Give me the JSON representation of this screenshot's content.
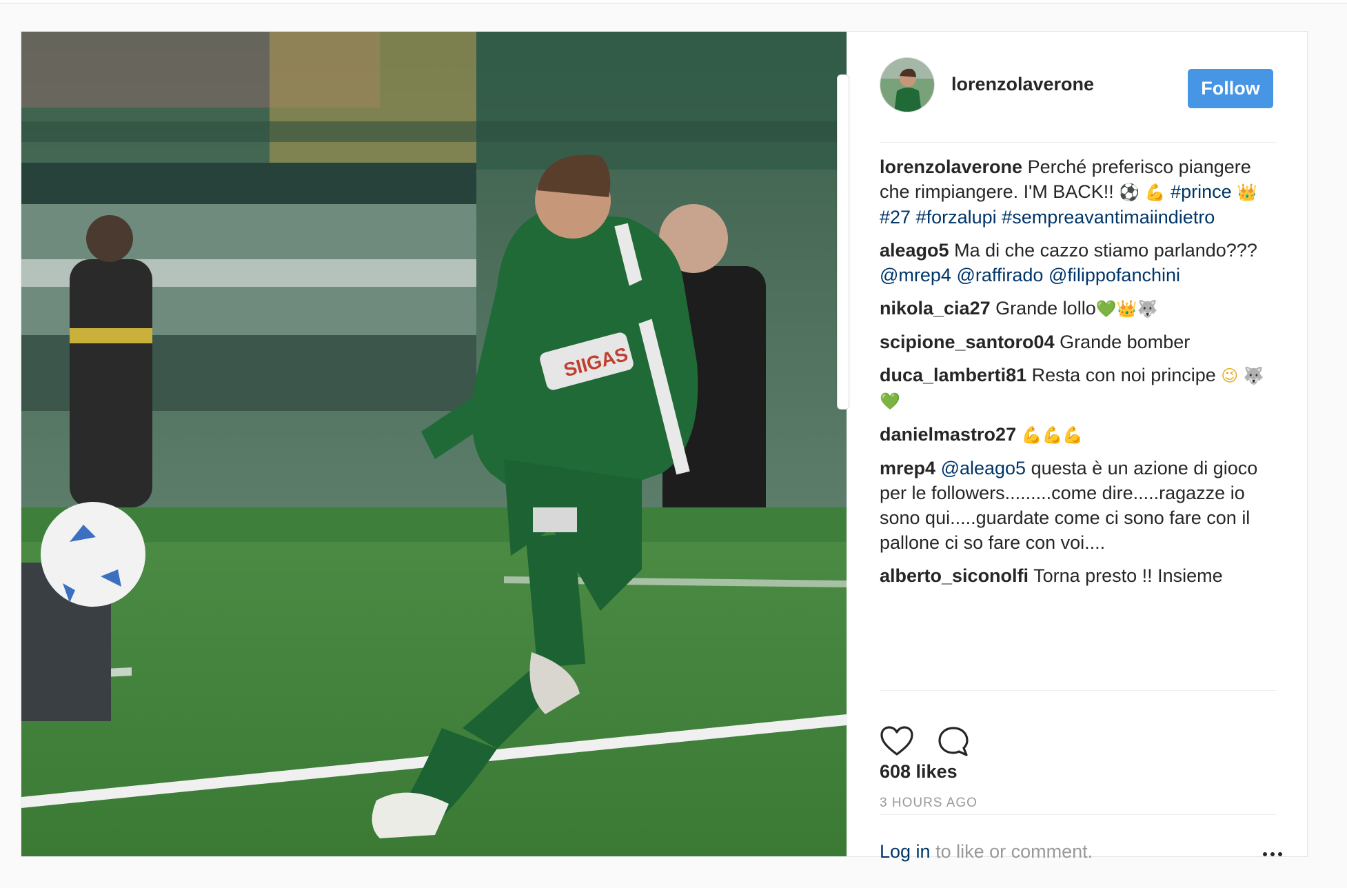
{
  "post": {
    "author": {
      "username": "lorenzolaverone",
      "follow_label": "Follow"
    },
    "caption": {
      "username": "lorenzolaverone",
      "text": "Perché preferisco piangere che rimpiangere. I'M BACK!! ",
      "emoji_1": "⚽",
      "emoji_2": "💪",
      "hashtag_1": "#prince",
      "emoji_3": "👑",
      "hashtag_2": "#27",
      "hashtag_3": "#forzalupi",
      "hashtag_4": "#sempreavantimaiindietro"
    },
    "comments": [
      {
        "username": "aleago5",
        "text": "Ma di che cazzo stiamo parlando??? ",
        "mention_1": "@mrep4",
        "mention_2": "@raffirado",
        "mention_3": "@filippofanchini"
      },
      {
        "username": "nikola_cia27",
        "text": "Grande lollo",
        "emoji_1": "💚",
        "emoji_2": "👑",
        "emoji_3": "🐺"
      },
      {
        "username": "scipione_santoro04",
        "text": "Grande bomber"
      },
      {
        "username": "duca_lamberti81",
        "text": "Resta con noi principe ",
        "emoji_1": "😉",
        "emoji_2": "🐺",
        "emoji_3": "💚"
      },
      {
        "username": "danielmastro27",
        "emoji_1": "💪",
        "emoji_2": "💪",
        "emoji_3": "💪"
      },
      {
        "username": "mrep4",
        "mention_1": "@aleago5",
        "text": " questa è un azione di gioco per le followers.........come dire.....ragazze io sono qui.....guardate come ci sono fare con il pallone ci so fare con voi...."
      },
      {
        "username": "alberto_siconolfi",
        "text": "Torna presto !! Insieme"
      }
    ],
    "likes": "608 likes",
    "timestamp": "3 HOURS AGO",
    "login": {
      "link_label": "Log in",
      "rest": " to like or comment."
    }
  },
  "colors": {
    "follow_button": "#4796e6",
    "link": "#003569",
    "muted": "#999999",
    "text": "#262626"
  },
  "icons": {
    "like": "heart-icon",
    "comment": "comment-bubble-icon",
    "more": "more-options-icon"
  }
}
